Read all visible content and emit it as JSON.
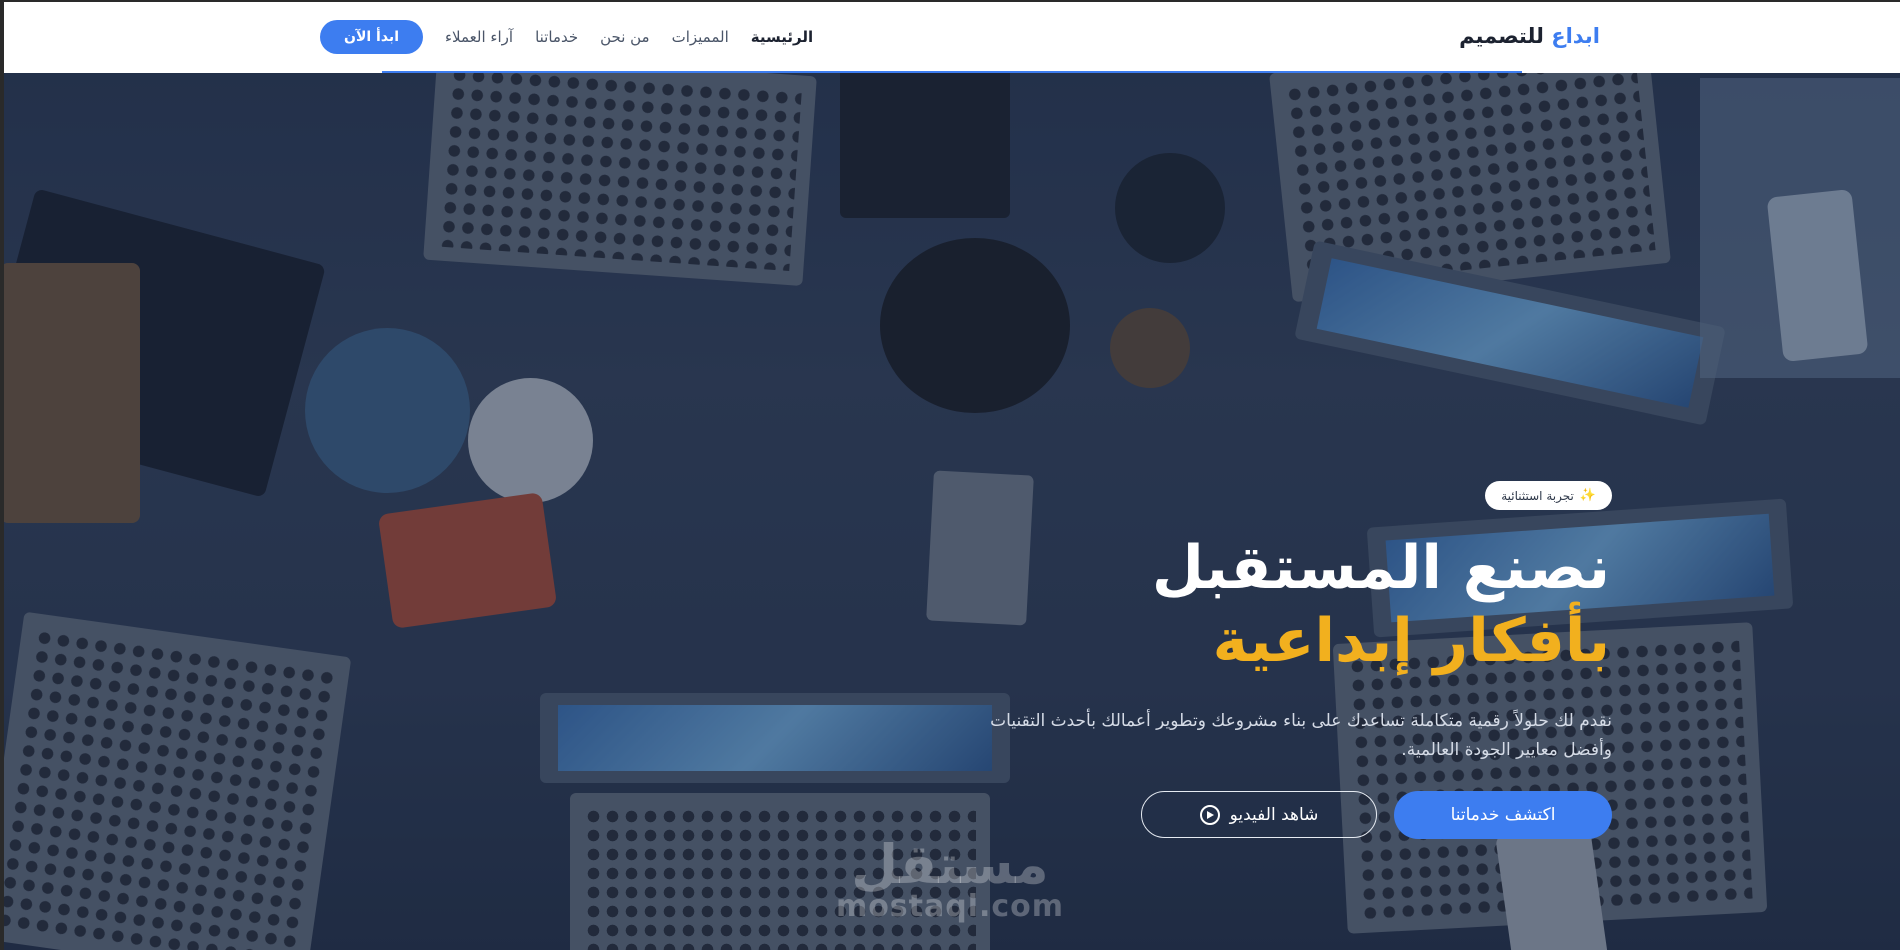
{
  "header": {
    "logo_accent": "ابداع",
    "logo_main": "للتصميم",
    "nav": [
      {
        "label": "الرئيسية",
        "active": true
      },
      {
        "label": "المميزات",
        "active": false
      },
      {
        "label": "من نحن",
        "active": false
      },
      {
        "label": "خدماتنا",
        "active": false
      },
      {
        "label": "آراء العملاء",
        "active": false
      }
    ],
    "cta_label": "ابدأ الآن"
  },
  "hero": {
    "badge_icon": "sparkle-icon",
    "badge_text": "تجربة استثنائية",
    "title_line1": "نصنع المستقبل",
    "title_line2": "بأفكار إبداعية",
    "description": "نقدم لك حلولاً رقمية متكاملة تساعدك على بناء مشروعك وتطوير أعمالك بأحدث التقنيات وأفضل معايير الجودة العالمية.",
    "primary_button": "اكتشف خدماتنا",
    "secondary_button": "شاهد الفيديو",
    "secondary_icon": "play-circle-icon"
  },
  "watermark": {
    "arabic": "مستقل",
    "latin": "mostaql.com"
  },
  "colors": {
    "accent": "#3d7df0",
    "highlight": "#f2b01e",
    "header_bg": "#ffffff"
  }
}
